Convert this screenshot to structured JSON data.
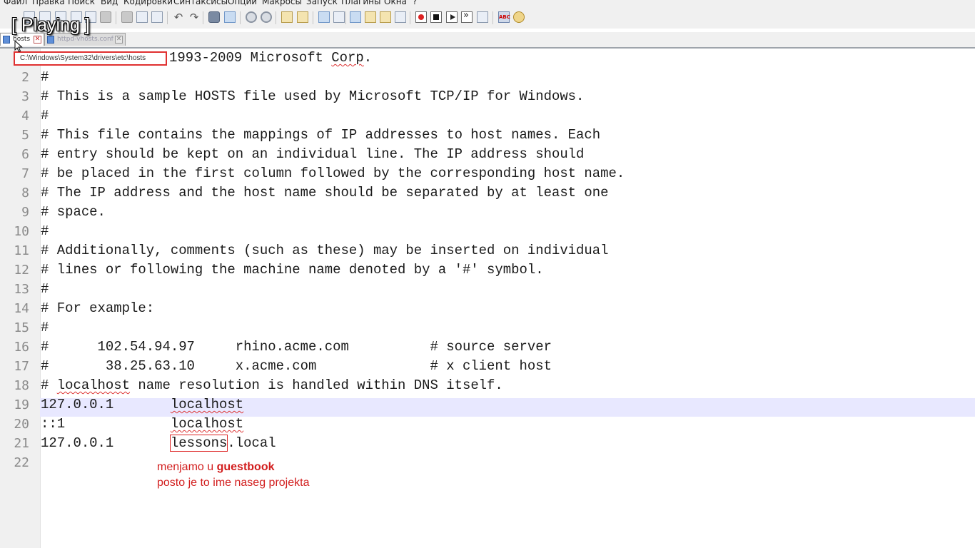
{
  "menu": [
    "Файл",
    "Правка",
    "Поиск",
    "Вид",
    "Кодировки",
    "Синтаксисы",
    "Опции",
    "Макросы",
    "Запуск",
    "Плагины",
    "Окна",
    "?"
  ],
  "overlay": {
    "playing": "[ Playing ]"
  },
  "tabs": [
    {
      "label": "hosts",
      "active": true
    },
    {
      "label": "httpd-vhosts.conf",
      "active": false
    }
  ],
  "tooltip": {
    "path": "C:\\Windows\\System32\\drivers\\etc\\hosts"
  },
  "editor": {
    "current_line": 19,
    "lines": [
      {
        "num": "1",
        "text": "1993-2009 Microsoft Corp."
      },
      {
        "num": "2",
        "text": "#"
      },
      {
        "num": "3",
        "text": "# This is a sample HOSTS file used by Microsoft TCP/IP for Windows."
      },
      {
        "num": "4",
        "text": "#"
      },
      {
        "num": "5",
        "text": "# This file contains the mappings of IP addresses to host names. Each"
      },
      {
        "num": "6",
        "text": "# entry should be kept on an individual line. The IP address should"
      },
      {
        "num": "7",
        "text": "# be placed in the first column followed by the corresponding host name."
      },
      {
        "num": "8",
        "text": "# The IP address and the host name should be separated by at least one"
      },
      {
        "num": "9",
        "text": "# space."
      },
      {
        "num": "10",
        "text": "#"
      },
      {
        "num": "11",
        "text": "# Additionally, comments (such as these) may be inserted on individual"
      },
      {
        "num": "12",
        "text": "# lines or following the machine name denoted by a '#' symbol."
      },
      {
        "num": "13",
        "text": "#"
      },
      {
        "num": "14",
        "text": "# For example:"
      },
      {
        "num": "15",
        "text": "#"
      },
      {
        "num": "16",
        "text": "#      102.54.94.97     rhino.acme.com          # source server"
      },
      {
        "num": "17",
        "text": "#       38.25.63.10     x.acme.com              # x client host"
      },
      {
        "num": "18",
        "text": "# localhost name resolution is handled within DNS itself."
      },
      {
        "num": "19",
        "text": "127.0.0.1       localhost"
      },
      {
        "num": "20",
        "text": "::1             localhost"
      },
      {
        "num": "21",
        "text": "127.0.0.1       lessons.local"
      },
      {
        "num": "22",
        "text": ""
      }
    ]
  },
  "annotation": {
    "line1_prefix": "menjamo u ",
    "line1_bold": "guestbook",
    "line2": "posto je to ime naseg projekta"
  }
}
